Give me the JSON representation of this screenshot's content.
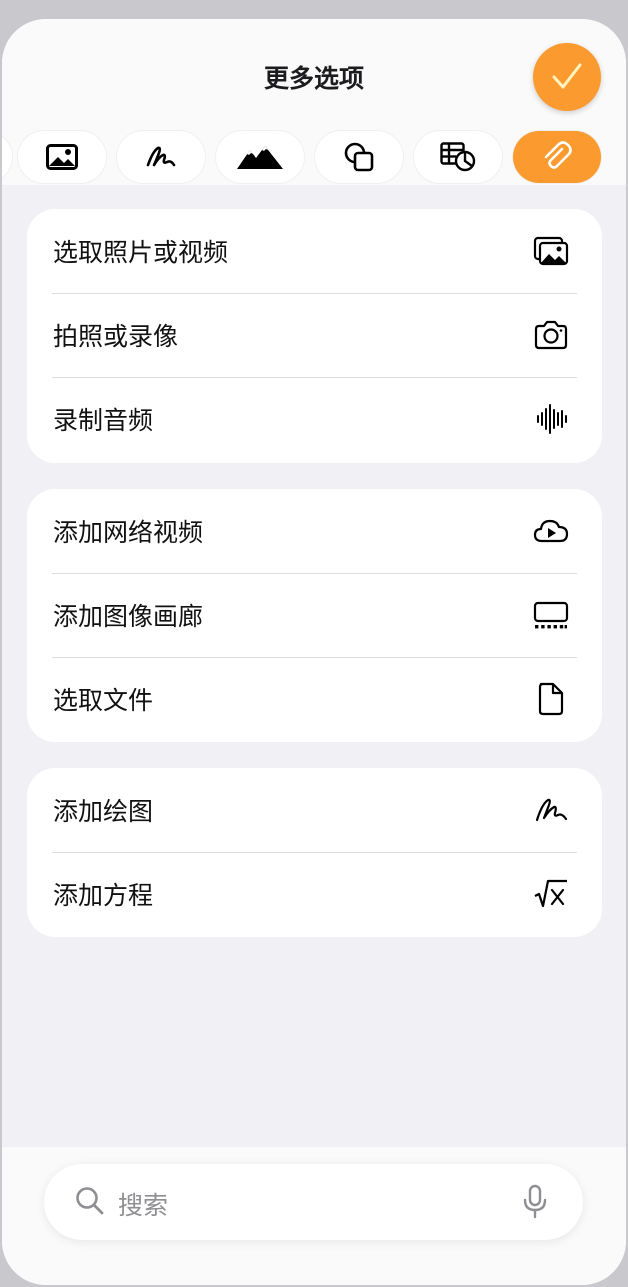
{
  "header": {
    "title": "更多选项"
  },
  "tabs": [
    {
      "icon": "pen-partial-icon"
    },
    {
      "icon": "photo-icon"
    },
    {
      "icon": "scribble-icon"
    },
    {
      "icon": "mountains-icon"
    },
    {
      "icon": "shapes-icon"
    },
    {
      "icon": "table-chart-icon"
    },
    {
      "icon": "paperclip-icon",
      "active": true
    }
  ],
  "groups": [
    {
      "rows": [
        {
          "label": "选取照片或视频",
          "icon": "photo-stack-icon"
        },
        {
          "label": "拍照或录像",
          "icon": "camera-icon"
        },
        {
          "label": "录制音频",
          "icon": "waveform-icon"
        }
      ]
    },
    {
      "rows": [
        {
          "label": "添加网络视频",
          "icon": "cloud-play-icon"
        },
        {
          "label": "添加图像画廊",
          "icon": "gallery-icon"
        },
        {
          "label": "选取文件",
          "icon": "document-icon"
        }
      ]
    },
    {
      "rows": [
        {
          "label": "添加绘图",
          "icon": "scribble-icon"
        },
        {
          "label": "添加方程",
          "icon": "square-root-icon"
        }
      ]
    }
  ],
  "search": {
    "placeholder": "搜索"
  },
  "colors": {
    "accent": "#fb9a2e",
    "background": "#f0f0f5",
    "card": "#ffffff"
  }
}
